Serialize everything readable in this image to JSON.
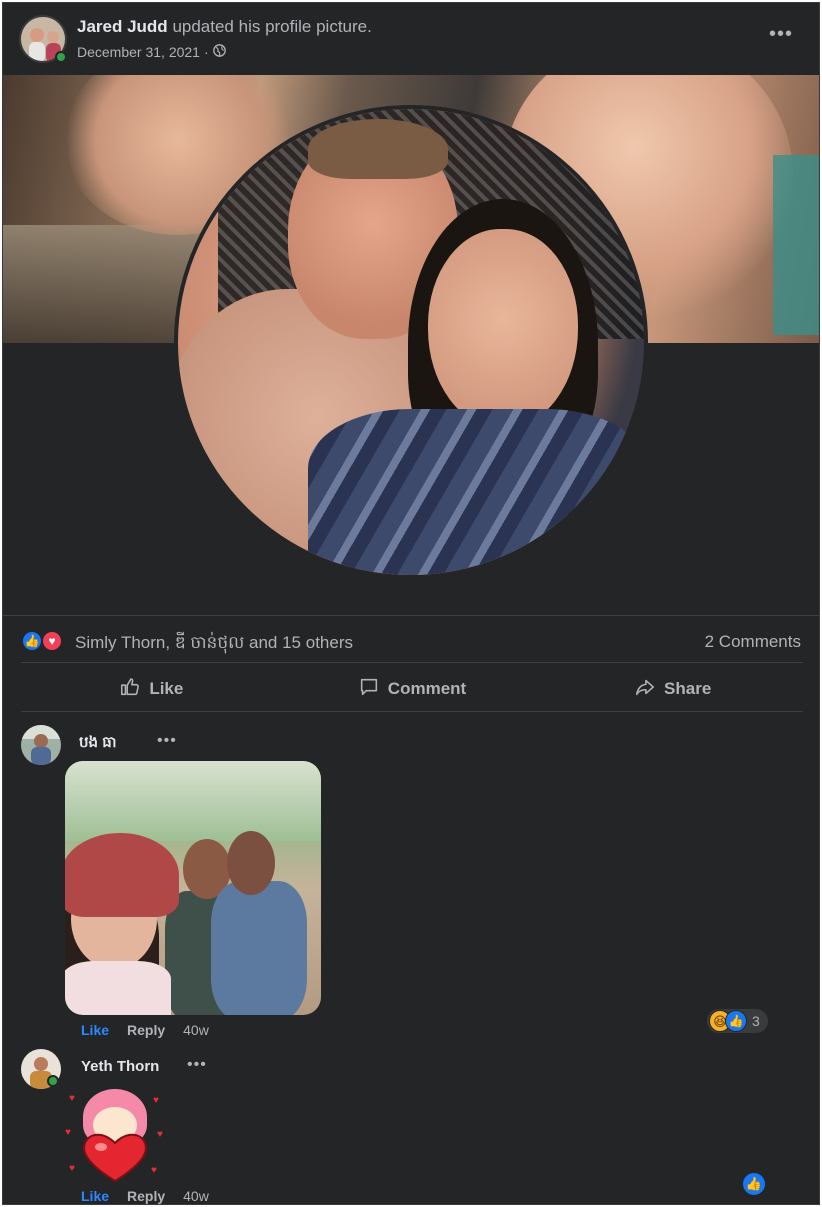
{
  "post": {
    "author": "Jared Judd",
    "action": "updated his profile picture.",
    "date": "December 31, 2021",
    "separator": "·",
    "privacy_icon": "globe-icon",
    "more_label": "•••"
  },
  "reactions": {
    "icons": [
      "like-icon",
      "love-icon"
    ],
    "summary": "Simly Thorn, ឌី ចាន់ថុល and 15 others",
    "comments_count": "2 Comments"
  },
  "actions": {
    "like": "Like",
    "comment": "Comment",
    "share": "Share"
  },
  "comments": [
    {
      "author": "បង ធា",
      "more": "•••",
      "has_photo": true,
      "like": "Like",
      "reply": "Reply",
      "time": "40w",
      "reaction_icons": [
        "haha-icon",
        "like-icon"
      ],
      "reaction_count": "3"
    },
    {
      "author": "Yeth Thorn",
      "more": "•••",
      "has_sticker": true,
      "online": true,
      "like": "Like",
      "reply": "Reply",
      "time": "40w",
      "reaction_icons": [
        "like-icon"
      ]
    }
  ],
  "colors": {
    "background": "#242526",
    "text_primary": "#e4e6eb",
    "text_secondary": "#b0b3b8",
    "like_blue": "#1877f2",
    "love_red": "#f33e58",
    "online_green": "#31a24c"
  }
}
